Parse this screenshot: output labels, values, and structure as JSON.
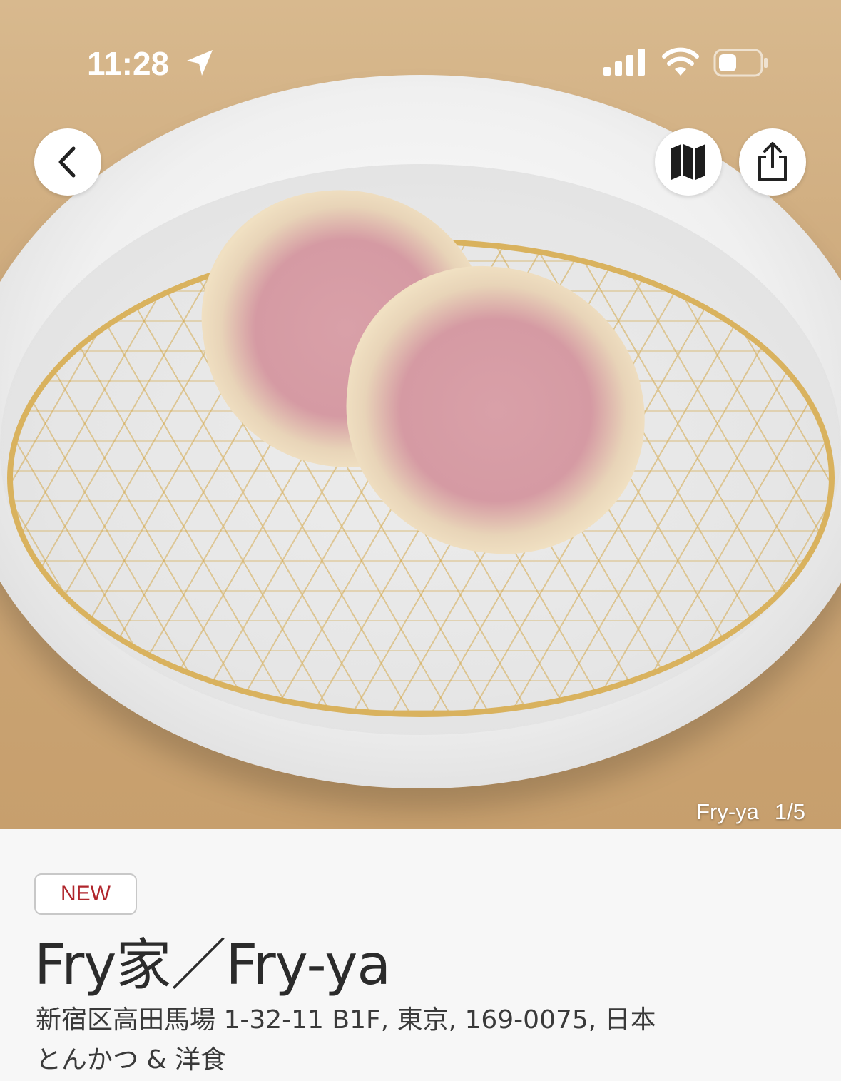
{
  "status_bar": {
    "time": "11:28"
  },
  "hero": {
    "photo_caption": "Fry-ya",
    "photo_counter": "1/5"
  },
  "restaurant": {
    "badge": "NEW",
    "name": "Fry家／Fry-ya",
    "address": "新宿区高田馬場 1-32-11 B1F, 東京, 169-0075, 日本",
    "category": "とんかつ & 洋食"
  },
  "icons": {
    "back": "chevron-left-icon",
    "map": "map-icon",
    "share": "share-icon",
    "location": "location-arrow-icon",
    "signal": "cellular-signal-icon",
    "wifi": "wifi-icon",
    "battery": "battery-icon"
  },
  "colors": {
    "badge_text": "#b0262c",
    "title_text": "#2b2b2b",
    "background": "#f7f7f7"
  }
}
